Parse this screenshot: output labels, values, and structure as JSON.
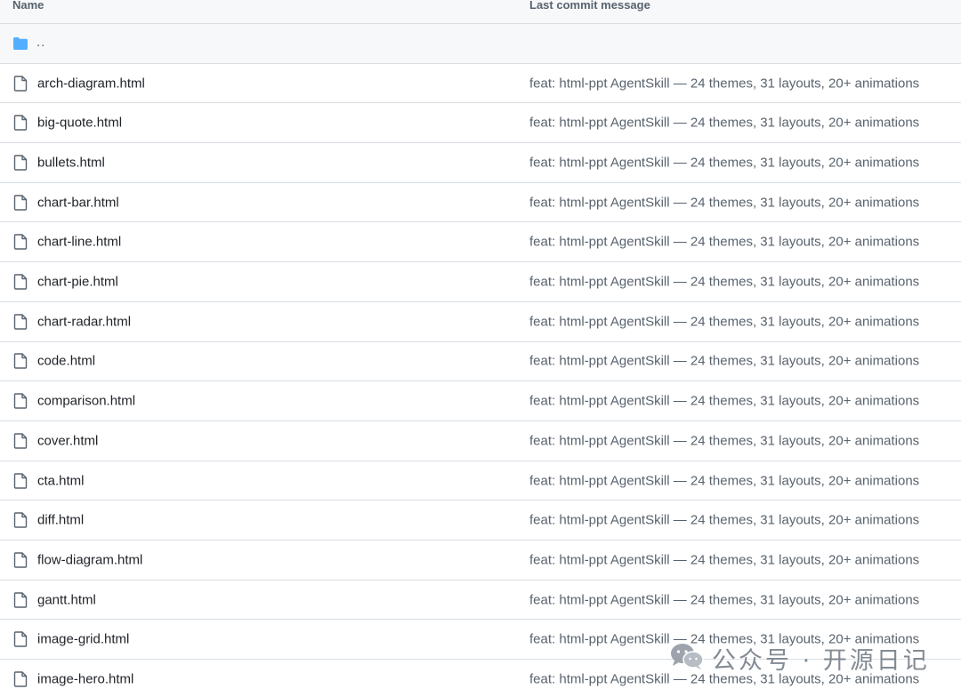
{
  "table": {
    "header": {
      "name_label": "Name",
      "message_label": "Last commit message"
    },
    "parent": {
      "label": "..",
      "icon": "folder-icon"
    },
    "rows": [
      {
        "name": "arch-diagram.html",
        "message": "feat: html-ppt AgentSkill — 24 themes, 31 layouts, 20+ animations"
      },
      {
        "name": "big-quote.html",
        "message": "feat: html-ppt AgentSkill — 24 themes, 31 layouts, 20+ animations"
      },
      {
        "name": "bullets.html",
        "message": "feat: html-ppt AgentSkill — 24 themes, 31 layouts, 20+ animations"
      },
      {
        "name": "chart-bar.html",
        "message": "feat: html-ppt AgentSkill — 24 themes, 31 layouts, 20+ animations"
      },
      {
        "name": "chart-line.html",
        "message": "feat: html-ppt AgentSkill — 24 themes, 31 layouts, 20+ animations"
      },
      {
        "name": "chart-pie.html",
        "message": "feat: html-ppt AgentSkill — 24 themes, 31 layouts, 20+ animations"
      },
      {
        "name": "chart-radar.html",
        "message": "feat: html-ppt AgentSkill — 24 themes, 31 layouts, 20+ animations"
      },
      {
        "name": "code.html",
        "message": "feat: html-ppt AgentSkill — 24 themes, 31 layouts, 20+ animations"
      },
      {
        "name": "comparison.html",
        "message": "feat: html-ppt AgentSkill — 24 themes, 31 layouts, 20+ animations"
      },
      {
        "name": "cover.html",
        "message": "feat: html-ppt AgentSkill — 24 themes, 31 layouts, 20+ animations"
      },
      {
        "name": "cta.html",
        "message": "feat: html-ppt AgentSkill — 24 themes, 31 layouts, 20+ animations"
      },
      {
        "name": "diff.html",
        "message": "feat: html-ppt AgentSkill — 24 themes, 31 layouts, 20+ animations"
      },
      {
        "name": "flow-diagram.html",
        "message": "feat: html-ppt AgentSkill — 24 themes, 31 layouts, 20+ animations"
      },
      {
        "name": "gantt.html",
        "message": "feat: html-ppt AgentSkill — 24 themes, 31 layouts, 20+ animations"
      },
      {
        "name": "image-grid.html",
        "message": "feat: html-ppt AgentSkill — 24 themes, 31 layouts, 20+ animations"
      },
      {
        "name": "image-hero.html",
        "message": "feat: html-ppt AgentSkill — 24 themes, 31 layouts, 20+ animations"
      }
    ],
    "row_icon": "file-icon"
  },
  "watermark": {
    "text": "公众号 · 开源日记",
    "icon": "wechat-icon"
  },
  "colors": {
    "folder": "#54aeff",
    "file_icon": "#59636e",
    "text_primary": "#1f2328",
    "text_muted": "#59636e",
    "border": "#d8dee4",
    "header_bg": "#f6f8fa"
  }
}
